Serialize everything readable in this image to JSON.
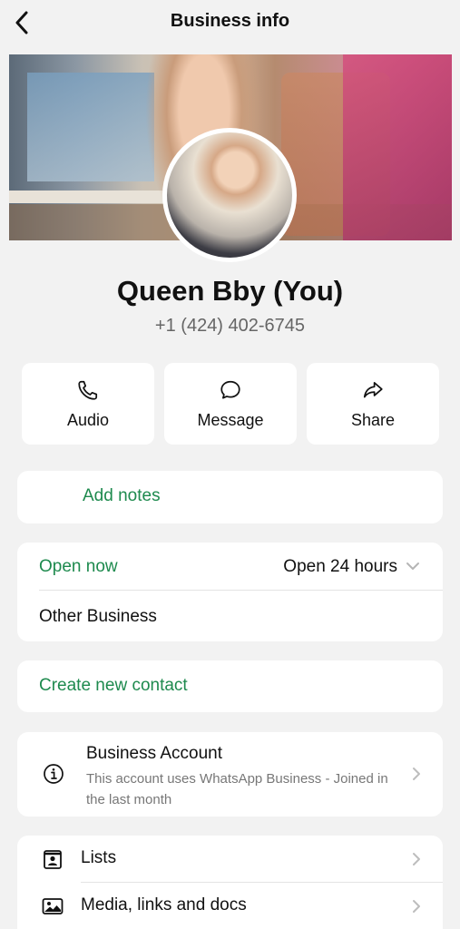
{
  "header": {
    "title": "Business info"
  },
  "profile": {
    "name": "Queen Bby (You)",
    "phone": "+1 (424) 402-6745"
  },
  "actions": [
    {
      "label": "Audio",
      "icon": "phone-icon"
    },
    {
      "label": "Message",
      "icon": "message-icon"
    },
    {
      "label": "Share",
      "icon": "share-icon"
    }
  ],
  "notes": {
    "label": "Add notes"
  },
  "hours": {
    "status": "Open now",
    "value": "Open 24 hours",
    "category": "Other Business"
  },
  "contact": {
    "label": "Create new contact"
  },
  "account": {
    "title": "Business Account",
    "description": "This account uses WhatsApp Business - Joined in the last month"
  },
  "lists": [
    {
      "label": "Lists",
      "icon": "lists-icon"
    },
    {
      "label": "Media, links and docs",
      "icon": "media-icon"
    }
  ],
  "colors": {
    "accent": "#1e8a4e",
    "background": "#f2f2f2",
    "card": "#ffffff"
  }
}
